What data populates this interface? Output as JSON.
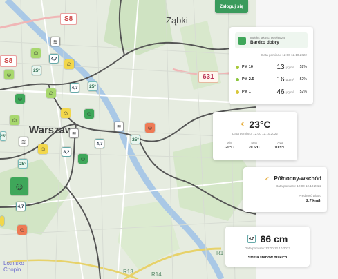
{
  "header": {
    "login_button": "Zaloguj się"
  },
  "map": {
    "city_labels": {
      "zabki": "Ząbki",
      "warszawa": "Warszawa",
      "lotnisko": "Lotnisko Chopin"
    },
    "road_badges": {
      "s8": "S8",
      "s8b": "S8",
      "r631": "631"
    },
    "road_labels": {
      "r13": "R13",
      "r14": "R14",
      "r1": "R1"
    },
    "markers": {
      "m1": "4,7",
      "m2": "25°",
      "m3": "4,7",
      "m4": "25°",
      "m5": "8,2",
      "m6": "4,7",
      "m7": "25°",
      "m8": "25°",
      "m9": "4,7",
      "m10": "25°"
    }
  },
  "air_card": {
    "quality_label": "Indeks jakości powietrza",
    "quality_value": "Bardzo dobry",
    "date_label": "Data pomiaru: 12:00 12.10.2022",
    "rows": [
      {
        "name": "PM 10",
        "value": "13",
        "unit": "µg/m³",
        "percent": "52%",
        "color": "#a8c93a"
      },
      {
        "name": "PM 2.5",
        "value": "16",
        "unit": "µg/m³",
        "percent": "52%",
        "color": "#8cc63f"
      },
      {
        "name": "PM 1",
        "value": "46",
        "unit": "µg/m³",
        "percent": "52%",
        "color": "#d8c73a"
      }
    ]
  },
  "temp_card": {
    "value": "23°C",
    "date_label": "Data pomiaru: 12:00 12.10.2022",
    "min_label": "Min",
    "min_value": "-20°C",
    "max_label": "Max",
    "max_value": "20.5°C",
    "avg_label": "Avg",
    "avg_value": "10.5°C"
  },
  "wind_card": {
    "direction": "Północny-wschód",
    "date_label": "Data pomiaru: 12:00 12.10.2022",
    "speed_label": "Prędkość wiatru",
    "speed_value": "2.7 km/h"
  },
  "water_card": {
    "icon_value": "4,7",
    "value": "86 cm",
    "date_label": "Data pomiaru: 12:00 12.10.2022",
    "zone": "Strefa stanów niskich"
  }
}
